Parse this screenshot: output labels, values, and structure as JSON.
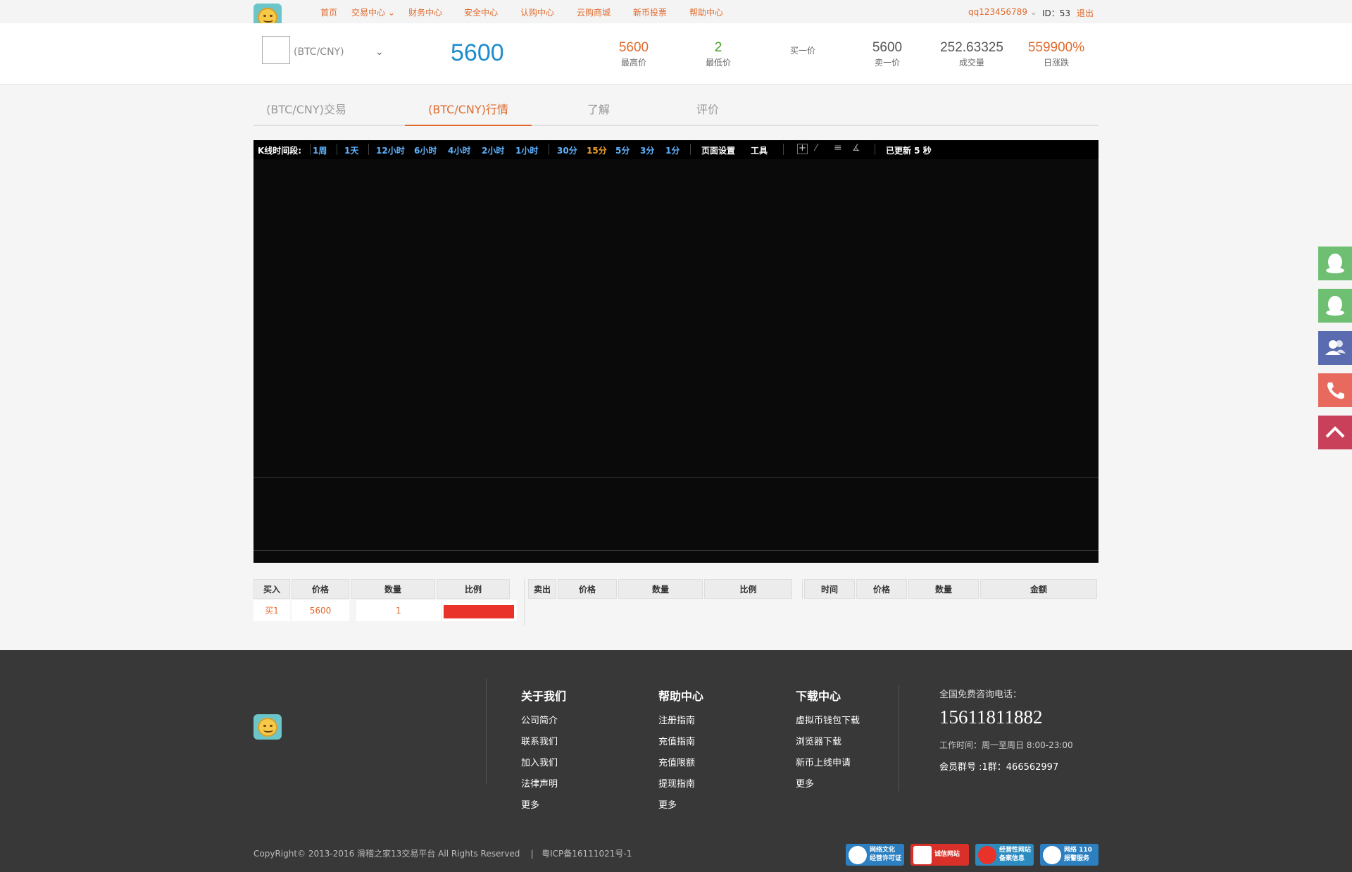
{
  "nav": {
    "items": [
      "首页",
      "交易中心",
      "财务中心",
      "安全中心",
      "认购中心",
      "云购商城",
      "新币投票",
      "帮助中心"
    ],
    "username": "qq123456789",
    "user_id": "ID：53",
    "logout": "退出"
  },
  "ticker": {
    "coin_label": "(BTC/CNY)",
    "current_price": "5600",
    "stats": [
      {
        "value": "5600",
        "label": "最高价",
        "color": "#e06a2c"
      },
      {
        "value": "2",
        "label": "最低价",
        "color": "#4aa02c"
      },
      {
        "value": "",
        "label": "买一价",
        "color": "#333333"
      },
      {
        "value": "5600",
        "label": "卖一价",
        "color": "#555555"
      },
      {
        "value": "252.63325",
        "label": "成交量",
        "color": "#555555"
      },
      {
        "value": "559900%",
        "label": "日涨跌",
        "color": "#e06a2c"
      }
    ]
  },
  "tabs": [
    "(BTC/CNY)交易",
    "(BTC/CNY)行情",
    "了解",
    "评价"
  ],
  "chart_toolbar": {
    "period_label": "K线时间段:",
    "periods": [
      "1周",
      "1天",
      "12小时",
      "6小时",
      "4小时",
      "2小时",
      "1小时",
      "30分",
      "15分",
      "5分",
      "3分",
      "1分"
    ],
    "active_period": "15分",
    "page_settings": "页面设置",
    "tools": "工具",
    "updated": "已更新 5 秒"
  },
  "buy_book": {
    "headers": [
      "买入",
      "价格",
      "数量",
      "比例"
    ],
    "rows": [
      {
        "side": "买1",
        "price": "5600",
        "qty": "1",
        "ratio": 1.0
      }
    ]
  },
  "sell_book": {
    "headers": [
      "卖出",
      "价格",
      "数量",
      "比例"
    ],
    "rows": []
  },
  "trade_history": {
    "headers": [
      "时间",
      "价格",
      "数量",
      "金额"
    ],
    "rows": []
  },
  "footer": {
    "columns": [
      {
        "title": "关于我们",
        "links": [
          "公司简介",
          "联系我们",
          "加入我们",
          "法律声明",
          "更多"
        ]
      },
      {
        "title": "帮助中心",
        "links": [
          "注册指南",
          "充值指南",
          "充值限额",
          "提现指南",
          "更多"
        ]
      },
      {
        "title": "下载中心",
        "links": [
          "虚拟币钱包下载",
          "浏览器下载",
          "新币上线申请",
          "更多"
        ]
      }
    ],
    "contact_title": "全国免费咨询电话：",
    "phone": "15611811882",
    "hours": "工作时间：周一至周日 8:00-23:00",
    "group": "会员群号 :1群：466562997",
    "copyright": "CopyRight© 2013-2016 滑稽之家13交易平台 All Rights Reserved",
    "icp": "粤ICP备16111021号-1",
    "badges": [
      {
        "line1": "网络文化",
        "line2": "经营许可证",
        "color": "#2c7fc0"
      },
      {
        "line1": "诚信网站",
        "line2": "",
        "color": "#d9302a"
      },
      {
        "line1": "经营性网站",
        "line2": "备案信息",
        "color": "#2c8cc0"
      },
      {
        "line1": "网络 110",
        "line2": "报警服务",
        "color": "#2c7fc0"
      }
    ]
  },
  "side_buttons": [
    {
      "icon": "qq-icon",
      "color": "#6fbf73"
    },
    {
      "icon": "qq-icon",
      "color": "#6fbf73"
    },
    {
      "icon": "users-icon",
      "color": "#5a6bb0"
    },
    {
      "icon": "phone-icon",
      "color": "#e86a5e"
    },
    {
      "icon": "up-arrow-icon",
      "color": "#c8405a"
    }
  ]
}
